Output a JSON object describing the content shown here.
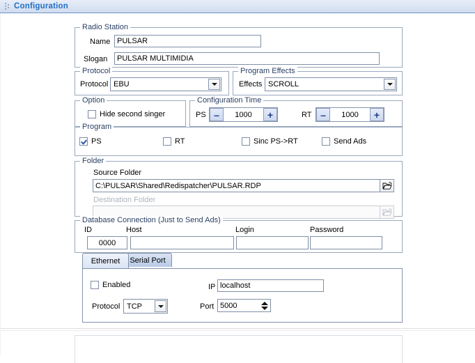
{
  "window": {
    "title": "Configuration"
  },
  "radio_station": {
    "legend": "Radio Station",
    "name_label": "Name",
    "name_value": "PULSAR",
    "slogan_label": "Slogan",
    "slogan_value": "PULSAR MULTIMIDIA"
  },
  "protocol": {
    "legend": "Protocol",
    "label": "Protocol",
    "value": "EBU"
  },
  "program_effects": {
    "legend": "Program Effects",
    "label": "Effects",
    "value": "SCROLL"
  },
  "option": {
    "legend": "Option",
    "hide_second_singer_label": "Hide second singer",
    "hide_second_singer_checked": false
  },
  "configuration_time": {
    "legend": "Configuration Time",
    "ps_label": "PS",
    "ps_value": "1000",
    "rt_label": "RT",
    "rt_value": "1000",
    "minus_label": "–",
    "plus_label": "+"
  },
  "program": {
    "legend": "Program",
    "items": [
      {
        "label": "PS",
        "checked": true
      },
      {
        "label": "RT",
        "checked": false
      },
      {
        "label": "Sinc PS->RT",
        "checked": false
      },
      {
        "label": "Send Ads",
        "checked": false
      }
    ]
  },
  "folder": {
    "legend": "Folder",
    "source_label": "Source Folder",
    "source_value": "C:\\PULSAR\\Shared\\Redispatcher\\PULSAR.RDP",
    "destination_label": "Destination Folder",
    "destination_value": ""
  },
  "database": {
    "legend": "Database Connection (Just to Send Ads)",
    "id_label": "ID",
    "id_value": "0000",
    "host_label": "Host",
    "host_value": "",
    "login_label": "Login",
    "login_value": "",
    "password_label": "Password",
    "password_value": ""
  },
  "connection_tabs": {
    "tabs": [
      {
        "label": "Ethernet",
        "selected": true
      },
      {
        "label": "Serial Port",
        "selected": false
      }
    ]
  },
  "ethernet": {
    "enabled_label": "Enabled",
    "enabled_checked": false,
    "protocol_label": "Protocol",
    "protocol_value": "TCP",
    "ip_label": "IP",
    "ip_value": "localhost",
    "port_label": "Port",
    "port_value": "5000"
  },
  "icons": {
    "grip": "drag-grip-icon",
    "browse": "folder-open-icon",
    "dropdown": "chevron-down-icon",
    "spinner": "up-down-arrows-icon"
  },
  "colors": {
    "title_text": "#1f6fc4",
    "titlebar_border": "#6f93c9",
    "group_border": "#9aa8bd",
    "legend_text": "#2a3f63",
    "spin_button": "#ccd8f0",
    "check_mark": "#2a56a8"
  }
}
